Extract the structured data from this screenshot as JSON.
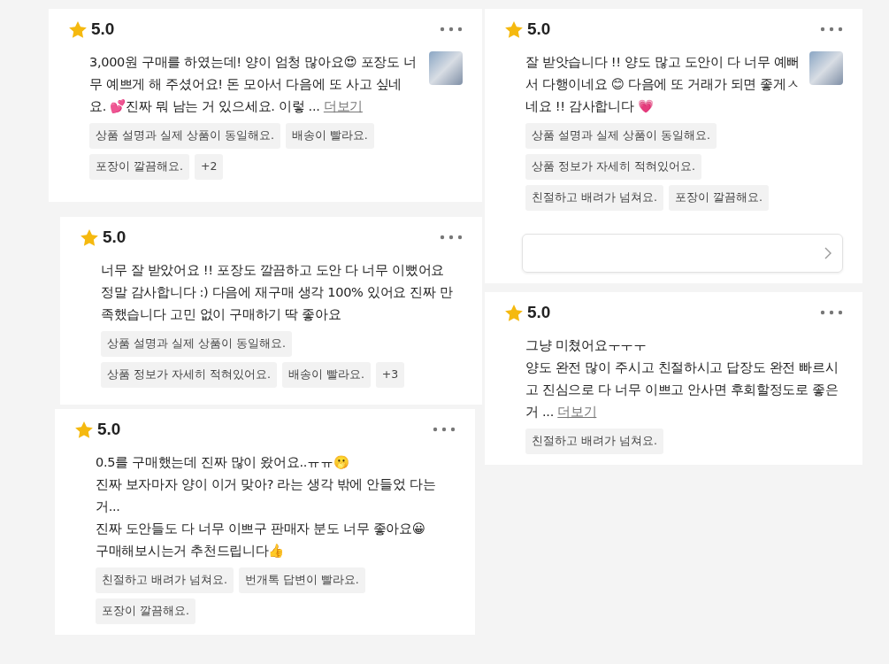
{
  "reviews": [
    {
      "rating": "5.0",
      "text": "3,000원 구매를 하였는데! 양이 엄청 많아요😍 포장도 너무 예쁘게 해 주셨어요! 돈 모아서 다음에 또 사고 싶네요. 💕진짜 뭐 남는 거 있으세요. 이렇 ...",
      "more_link": "더보기",
      "has_photo": true,
      "has_link_box": false,
      "tags": [
        "상품 설명과 실제 상품이 동일해요.",
        "배송이 빨라요.",
        "포장이 깔끔해요.",
        "+2"
      ]
    },
    {
      "rating": "5.0",
      "text": "너무 잘 받았어요 !! 포장도 깔끔하고 도안 다 너무 이뻤어요\n정말 감사합니다 :) 다음에 재구매 생각 100% 있어요 진짜 만족했습니다 고민 없이 구매하기 딱 좋아요",
      "has_photo": false,
      "has_link_box": false,
      "tags": [
        "상품 설명과 실제 상품이 동일해요.",
        "상품 정보가 자세히 적혀있어요.",
        "배송이 빨라요.",
        "+3"
      ]
    },
    {
      "rating": "5.0",
      "text": "0.5를 구매했는데 진짜 많이 왔어요..ㅠㅠ🫢\n진짜 보자마자 양이 이거 맞아? 라는 생각 밖에 안들었 다는 거...\n진짜 도안들도 다 너무 이쁘구 판매자 분도 너무 좋아요😀\n구매해보시는거 추천드립니다👍",
      "has_photo": false,
      "has_link_box": false,
      "tags": [
        "친절하고 배려가 넘쳐요.",
        "번개톡 답변이 빨라요.",
        "포장이 깔끔해요."
      ]
    },
    {
      "rating": "5.0",
      "text": "잘 받앗습니다 !! 양도 많고 도안이 다 너무 예뻐서 다행이네요 😊 다음에 또 거래가 되면 좋게ㅅ네요 !! 감사합니다 💗",
      "has_photo": true,
      "has_link_box": true,
      "tags": [
        "상품 설명과 실제 상품이 동일해요.",
        "상품 정보가 자세히 적혀있어요.",
        "친절하고 배려가 넘쳐요.",
        "포장이 깔끔해요."
      ]
    },
    {
      "rating": "5.0",
      "text": "그냥 미쳤어요ㅜㅜㅜ\n양도 완전 많이 주시고 친절하시고 답장도 완전 빠르시고 진심으로 다 너무 이쁘고 안사면 후회할정도로 좋은거  ...",
      "more_link": "더보기",
      "has_photo": false,
      "has_link_box": false,
      "tags": [
        "친절하고 배려가 넘쳐요."
      ]
    }
  ]
}
